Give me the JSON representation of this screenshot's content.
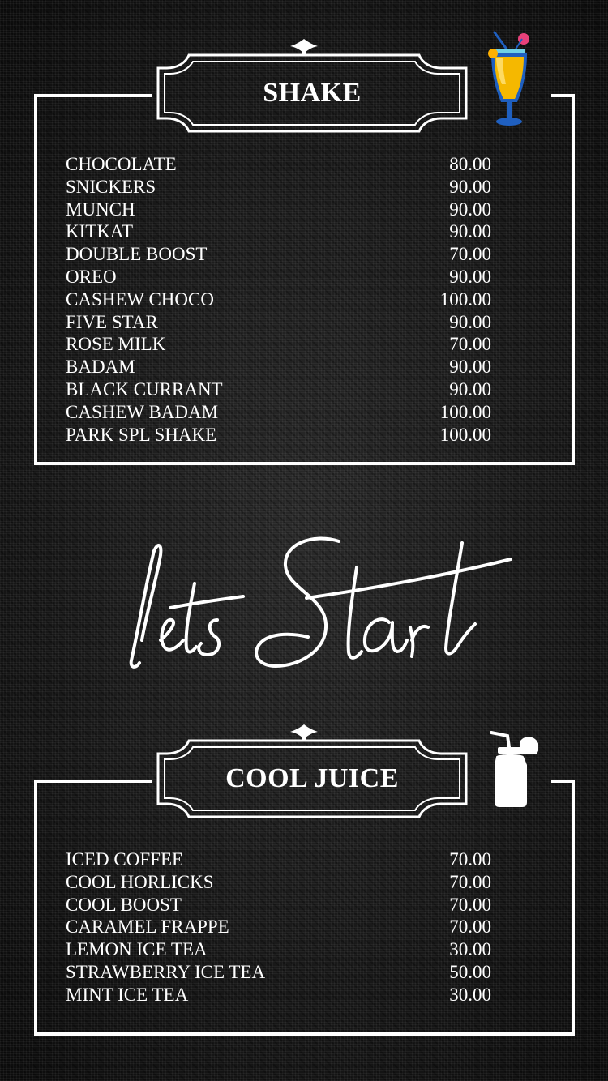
{
  "sections": [
    {
      "title": "SHAKE",
      "icon": "cocktail-glass-icon",
      "items": [
        {
          "name": "CHOCOLATE",
          "price": "80.00"
        },
        {
          "name": "SNICKERS",
          "price": "90.00"
        },
        {
          "name": "MUNCH",
          "price": "90.00"
        },
        {
          "name": "KITKAT",
          "price": "90.00"
        },
        {
          "name": "DOUBLE BOOST",
          "price": "70.00"
        },
        {
          "name": "OREO",
          "price": "90.00"
        },
        {
          "name": "CASHEW CHOCO",
          "price": "100.00"
        },
        {
          "name": "FIVE STAR",
          "price": "90.00"
        },
        {
          "name": "ROSE MILK",
          "price": "70.00"
        },
        {
          "name": "BADAM",
          "price": "90.00"
        },
        {
          "name": "BLACK CURRANT",
          "price": "90.00"
        },
        {
          "name": "CASHEW BADAM",
          "price": "100.00"
        },
        {
          "name": "PARK SPL SHAKE",
          "price": "100.00"
        }
      ]
    },
    {
      "title": "COOL JUICE",
      "icon": "juice-bottle-icon",
      "items": [
        {
          "name": "ICED COFFEE",
          "price": "70.00"
        },
        {
          "name": "COOL HORLICKS",
          "price": "70.00"
        },
        {
          "name": "COOL BOOST",
          "price": "70.00"
        },
        {
          "name": "CARAMEL FRAPPE",
          "price": "70.00"
        },
        {
          "name": "LEMON ICE TEA",
          "price": "30.00"
        },
        {
          "name": "STRAWBERRY ICE TEA",
          "price": "50.00"
        },
        {
          "name": "MINT ICE TEA",
          "price": "30.00"
        }
      ]
    }
  ],
  "script_heading": "Lets Start",
  "colors": {
    "background": "#161616",
    "text": "#ffffff",
    "drink_yellow": "#f5b800",
    "glass_blue": "#1f5fbf",
    "straw_pink": "#e8417a"
  }
}
